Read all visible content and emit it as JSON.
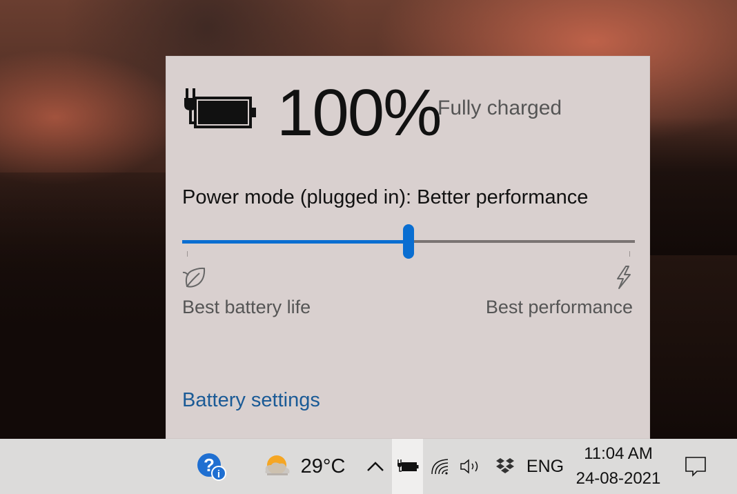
{
  "battery_flyout": {
    "percent": "100%",
    "status": "Fully charged",
    "power_mode_label": "Power mode (plugged in): Better performance",
    "slider_level": 0.5,
    "left_end_label": "Best battery life",
    "right_end_label": "Best performance",
    "settings_link": "Battery settings",
    "accent_color": "#0a6ed1",
    "link_color": "#1a5a96"
  },
  "taskbar": {
    "icons": [
      "help-icon",
      "weather-icon",
      "chevron-up-icon",
      "battery-plug-icon",
      "wifi-icon",
      "volume-icon",
      "dropbox-icon",
      "notification-icon"
    ],
    "temperature": "29°C",
    "language": "ENG",
    "time": "11:04 AM",
    "date": "24-08-2021"
  }
}
